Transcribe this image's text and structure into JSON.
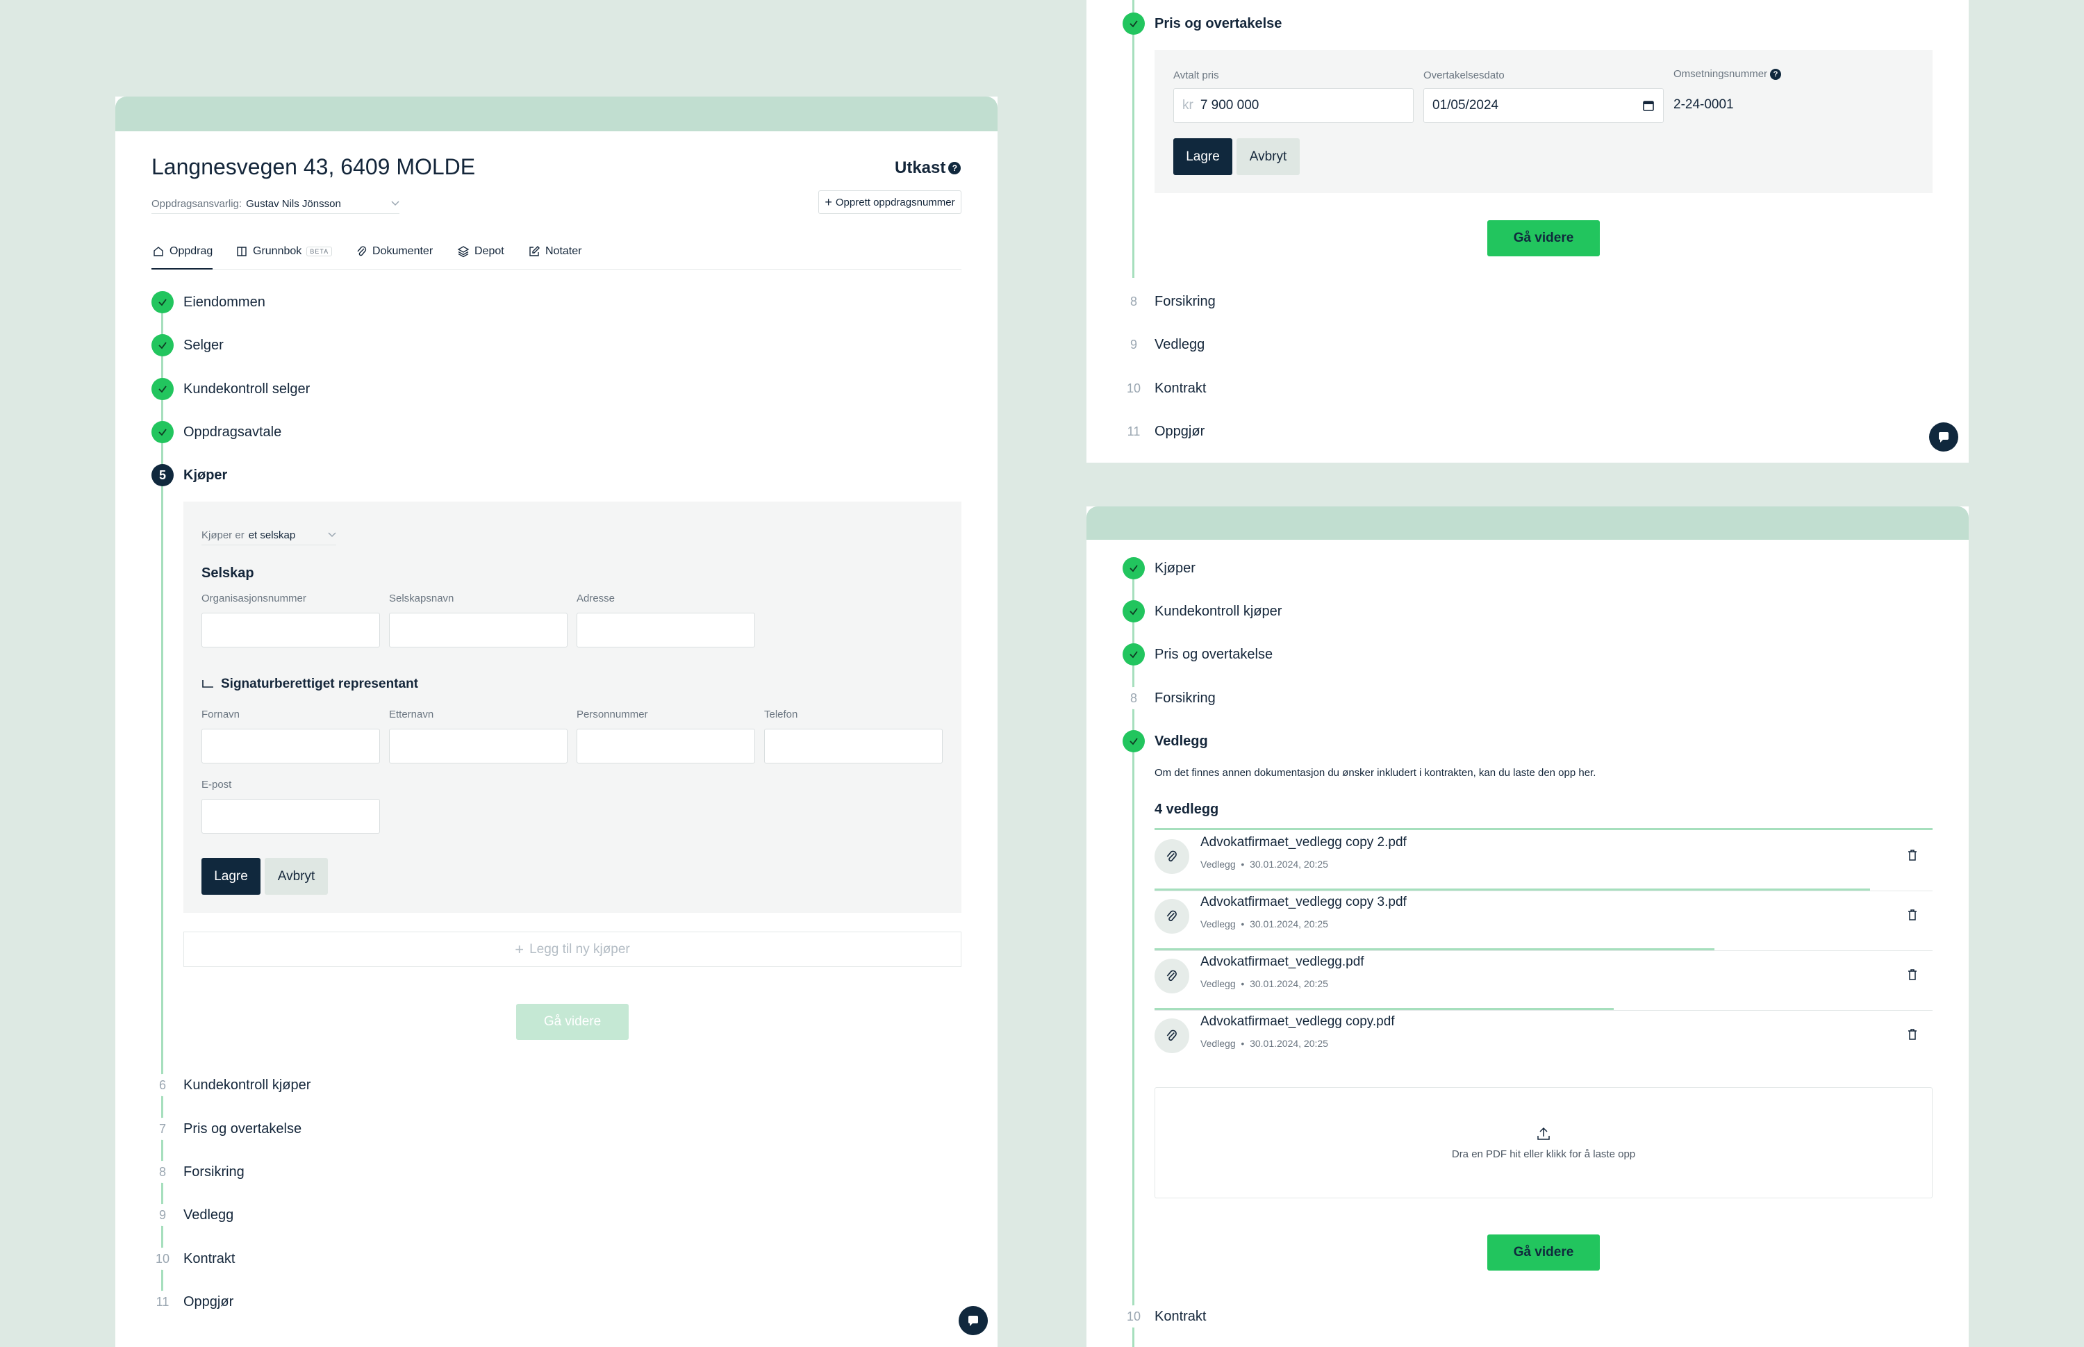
{
  "left": {
    "title": "Langnesvegen 43, 6409 MOLDE",
    "status": "Utkast",
    "responsible_label": "Oppdragsansvarlig:",
    "responsible_value": "Gustav Nils Jönsson",
    "create_button": "Opprett oppdragsnummer",
    "tabs": [
      {
        "label": "Oppdrag",
        "icon": "home-icon"
      },
      {
        "label": "Grunnbok",
        "badge": "BETA",
        "icon": "book-icon"
      },
      {
        "label": "Dokumenter",
        "icon": "paperclip-icon"
      },
      {
        "label": "Depot",
        "icon": "layers-icon"
      },
      {
        "label": "Notater",
        "icon": "edit-icon"
      }
    ],
    "steps": [
      {
        "num": "",
        "label": "Eiendommen",
        "state": "done"
      },
      {
        "num": "",
        "label": "Selger",
        "state": "done"
      },
      {
        "num": "",
        "label": "Kundekontroll selger",
        "state": "done"
      },
      {
        "num": "",
        "label": "Oppdragsavtale",
        "state": "done"
      },
      {
        "num": "5",
        "label": "Kjøper",
        "state": "current"
      },
      {
        "num": "6",
        "label": "Kundekontroll kjøper",
        "state": "todo"
      },
      {
        "num": "7",
        "label": "Pris og overtakelse",
        "state": "todo"
      },
      {
        "num": "8",
        "label": "Forsikring",
        "state": "todo"
      },
      {
        "num": "9",
        "label": "Vedlegg",
        "state": "todo"
      },
      {
        "num": "10",
        "label": "Kontrakt",
        "state": "todo"
      },
      {
        "num": "11",
        "label": "Oppgjør",
        "state": "todo"
      }
    ],
    "buyer_form": {
      "buyer_is_label": "Kjøper er",
      "buyer_is_value": "et selskap",
      "company_heading": "Selskap",
      "org_label": "Organisasjonsnummer",
      "company_name_label": "Selskapsnavn",
      "address_label": "Adresse",
      "rep_heading": "Signaturberettiget representant",
      "first_name_label": "Fornavn",
      "last_name_label": "Etternavn",
      "person_number_label": "Personnummer",
      "phone_label": "Telefon",
      "email_label": "E-post",
      "save": "Lagre",
      "cancel": "Avbryt"
    },
    "add_buyer": "Legg til ny kjøper",
    "continue": "Gå videre"
  },
  "right_top": {
    "steps": [
      {
        "num": "",
        "label": "Pris og overtakelse",
        "state": "done"
      },
      {
        "num": "8",
        "label": "Forsikring",
        "state": "todo"
      },
      {
        "num": "9",
        "label": "Vedlegg",
        "state": "todo"
      },
      {
        "num": "10",
        "label": "Kontrakt",
        "state": "todo"
      },
      {
        "num": "11",
        "label": "Oppgjør",
        "state": "todo"
      }
    ],
    "price_label": "Avtalt pris",
    "price_prefix": "kr",
    "price_value": "7 900 000",
    "date_label": "Overtakelsesdato",
    "date_value": "01/05/2024",
    "turnover_label": "Omsetningsnummer",
    "turnover_value": "2-24-0001",
    "save": "Lagre",
    "cancel": "Avbryt",
    "continue": "Gå videre"
  },
  "right_bottom": {
    "steps": [
      {
        "num": "",
        "label": "Kjøper",
        "state": "done"
      },
      {
        "num": "",
        "label": "Kundekontroll kjøper",
        "state": "done"
      },
      {
        "num": "",
        "label": "Pris og overtakelse",
        "state": "done"
      },
      {
        "num": "8",
        "label": "Forsikring",
        "state": "todo"
      },
      {
        "num": "",
        "label": "Vedlegg",
        "state": "done"
      }
    ],
    "description": "Om det finnes annen dokumentasjon du ønsker inkludert i kontrakten, kan du laste den opp her.",
    "count_label": "4 vedlegg",
    "files": [
      {
        "name": "Advokatfirmaet_vedlegg copy 2.pdf",
        "type": "Vedlegg",
        "date": "30.01.2024, 20:25",
        "progress": 0.92
      },
      {
        "name": "Advokatfirmaet_vedlegg copy 3.pdf",
        "type": "Vedlegg",
        "date": "30.01.2024, 20:25",
        "progress": 0.72
      },
      {
        "name": "Advokatfirmaet_vedlegg.pdf",
        "type": "Vedlegg",
        "date": "30.01.2024, 20:25",
        "progress": 0.59
      },
      {
        "name": "Advokatfirmaet_vedlegg copy.pdf",
        "type": "Vedlegg",
        "date": "30.01.2024, 20:25",
        "progress": 0
      }
    ],
    "upload_text": "Dra en PDF hit eller klikk for å laste opp",
    "continue": "Gå videre",
    "last_step": {
      "num": "10",
      "label": "Kontrakt"
    }
  }
}
